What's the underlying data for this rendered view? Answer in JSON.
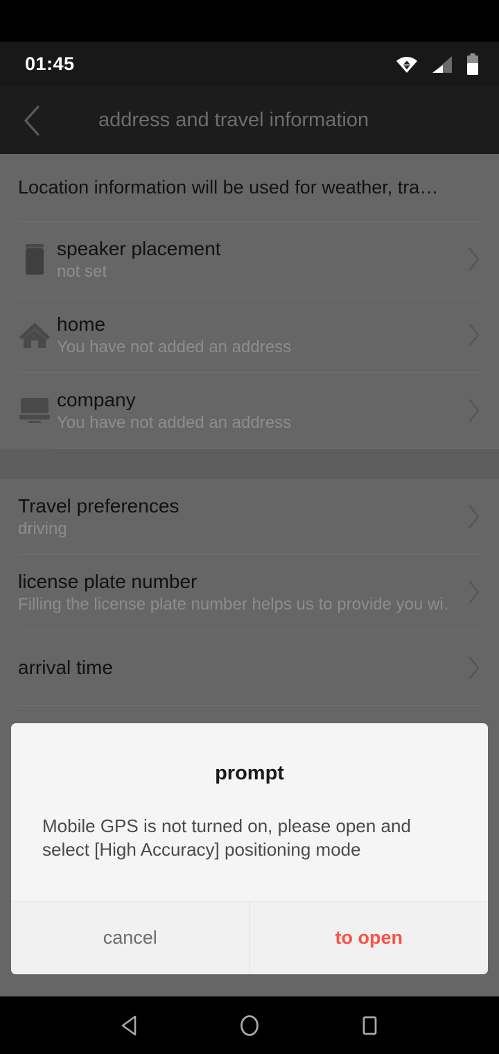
{
  "status_bar": {
    "clock": "01:45",
    "icons": [
      "wifi-icon",
      "cellular-signal-icon",
      "battery-icon"
    ]
  },
  "app_bar": {
    "back_icon": "chevron-left-icon",
    "title": "address and travel information"
  },
  "content": {
    "intro_text": "Location information will be used for weather, tra…",
    "sections": [
      {
        "rows": [
          {
            "icon": "speaker-icon",
            "title": "speaker placement",
            "subtitle": "not set",
            "chevron": "chevron-right-icon"
          },
          {
            "icon": "home-icon",
            "title": "home",
            "subtitle": "You have not added an address",
            "chevron": "chevron-right-icon"
          },
          {
            "icon": "monitor-icon",
            "title": "company",
            "subtitle": "You have not added an address",
            "chevron": "chevron-right-icon"
          }
        ]
      },
      {
        "rows": [
          {
            "icon": null,
            "title": "Travel preferences",
            "subtitle": "driving",
            "chevron": "chevron-right-icon"
          },
          {
            "icon": null,
            "title": "license plate number",
            "subtitle": "Filling the license plate number helps us to provide you wi…",
            "chevron": "chevron-right-icon"
          },
          {
            "icon": null,
            "title": "arrival time",
            "subtitle": null,
            "chevron": "chevron-right-icon"
          }
        ]
      }
    ]
  },
  "dialog": {
    "title": "prompt",
    "message": "Mobile GPS is not turned on, please open and select [High Accuracy] positioning mode",
    "cancel_label": "cancel",
    "confirm_label": "to open",
    "confirm_color": "#fb5342"
  },
  "nav_bar": {
    "back_icon": "triangle-back-icon",
    "home_icon": "circle-home-icon",
    "recents_icon": "square-recents-icon"
  }
}
